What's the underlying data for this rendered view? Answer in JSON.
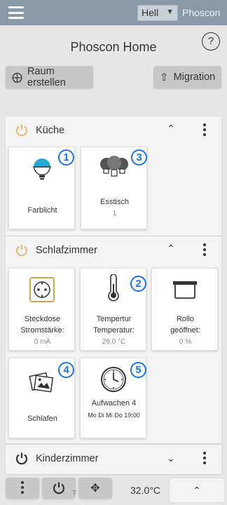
{
  "header": {
    "theme_value": "Hell",
    "brand": "Phoscon"
  },
  "page": {
    "title": "Phoscon Home",
    "help_label": "?"
  },
  "actions": {
    "create_room_label": "Raum erstellen",
    "migration_label": "Migration"
  },
  "rooms": [
    {
      "name": "Küche",
      "power_color": "#e8b86b",
      "tiles": [
        {
          "title": "Farblicht",
          "subtitle": "",
          "badge": "1",
          "icon": "bulb-icon"
        },
        {
          "title": "Esstisch",
          "subtitle": "1",
          "badge": "3",
          "icon": "bulb-group-icon"
        }
      ]
    },
    {
      "name": "Schlafzimmer",
      "power_color": "#e8b86b",
      "tiles": [
        {
          "title": "Steckdose",
          "subtitle_line": "Stromstärke:",
          "value": "0 mA",
          "icon": "socket-icon"
        },
        {
          "title": "Tempertur",
          "subtitle_line": "Temperatur:",
          "value": "29.0 °C",
          "badge": "2",
          "icon": "thermometer-icon"
        },
        {
          "title": "Rollo",
          "subtitle_line": "geöffnet:",
          "value": "0 %",
          "icon": "blind-icon"
        },
        {
          "title": "Schlafen",
          "badge": "4",
          "icon": "scene-icon"
        },
        {
          "title": "Aufwachen 4",
          "subtitle_line": "Mo Di Mi Do 19:00",
          "badge": "5",
          "icon": "clock-icon"
        }
      ]
    },
    {
      "name": "Kinderzimmer",
      "power_color": "#333333"
    }
  ],
  "bottom": {
    "temperature": "32.0°C",
    "faint_letter": "T"
  },
  "colors": {
    "header_bg": "#8a9aa9",
    "accent_blue": "#1a73e8",
    "power_on": "#e8b86b",
    "bulb_color": "#29a8d6"
  }
}
